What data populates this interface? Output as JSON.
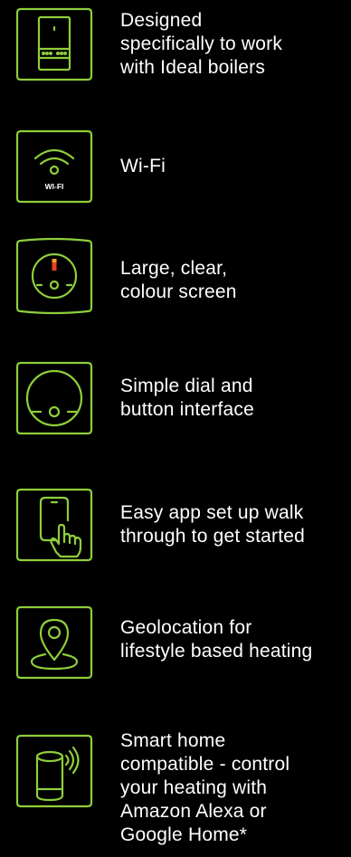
{
  "accent_color": "#8fce3a",
  "features": [
    {
      "icon": "boiler-icon",
      "text": "Designed\nspecifically to work\nwith Ideal boilers"
    },
    {
      "icon": "wifi-icon",
      "text": "Wi-Fi",
      "icon_label": "WI-FI"
    },
    {
      "icon": "colour-screen-icon",
      "text": "Large, clear,\ncolour screen"
    },
    {
      "icon": "dial-button-icon",
      "text": "Simple dial and\nbutton interface"
    },
    {
      "icon": "phone-tap-icon",
      "text": "Easy app set up walk\nthrough to get started"
    },
    {
      "icon": "location-pin-icon",
      "text": "Geolocation for\nlifestyle based heating"
    },
    {
      "icon": "smart-speaker-icon",
      "text": "Smart home\ncompatible - control\nyour heating with\nAmazon Alexa or\nGoogle Home*"
    }
  ]
}
